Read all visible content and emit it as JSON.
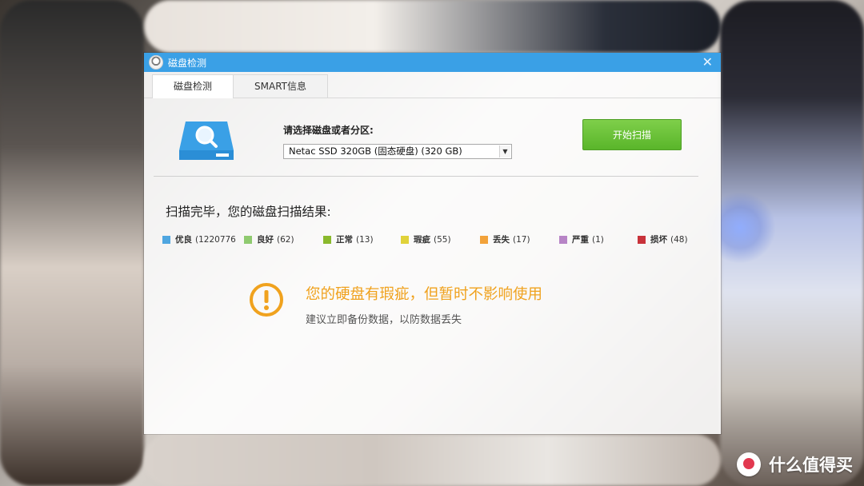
{
  "window": {
    "title": "磁盘检测",
    "close_glyph": "✕"
  },
  "tabs": [
    {
      "label": "磁盘检测",
      "active": true
    },
    {
      "label": "SMART信息",
      "active": false
    }
  ],
  "disk_select": {
    "label": "请选择磁盘或者分区:",
    "value": "Netac  SSD  320GB (固态硬盘)  (320 GB)",
    "arrow_glyph": "▼"
  },
  "start_button": {
    "label": "开始扫描"
  },
  "result": {
    "title": "扫描完毕，您的磁盘扫描结果:"
  },
  "legend": [
    {
      "label": "优良",
      "count": "(1220776",
      "color": "#4fa6e0"
    },
    {
      "label": "良好",
      "count": "(62)",
      "color": "#8fca6f"
    },
    {
      "label": "正常",
      "count": "(13)",
      "color": "#8ab92d"
    },
    {
      "label": "瑕疵",
      "count": "(55)",
      "color": "#e0d23a"
    },
    {
      "label": "丢失",
      "count": "(17)",
      "color": "#f2a23a"
    },
    {
      "label": "严重",
      "count": "(1)",
      "color": "#b784c6"
    },
    {
      "label": "损坏",
      "count": "(48)",
      "color": "#c8323a"
    }
  ],
  "warning": {
    "title": "您的硬盘有瑕疵，但暂时不影响使用",
    "subtitle": "建议立即备份数据，以防数据丢失"
  },
  "watermark": {
    "text": "什么值得买"
  },
  "colors": {
    "titlebar": "#3aa0e6",
    "start_button": "#6cc238",
    "warning": "#f0a21e"
  }
}
